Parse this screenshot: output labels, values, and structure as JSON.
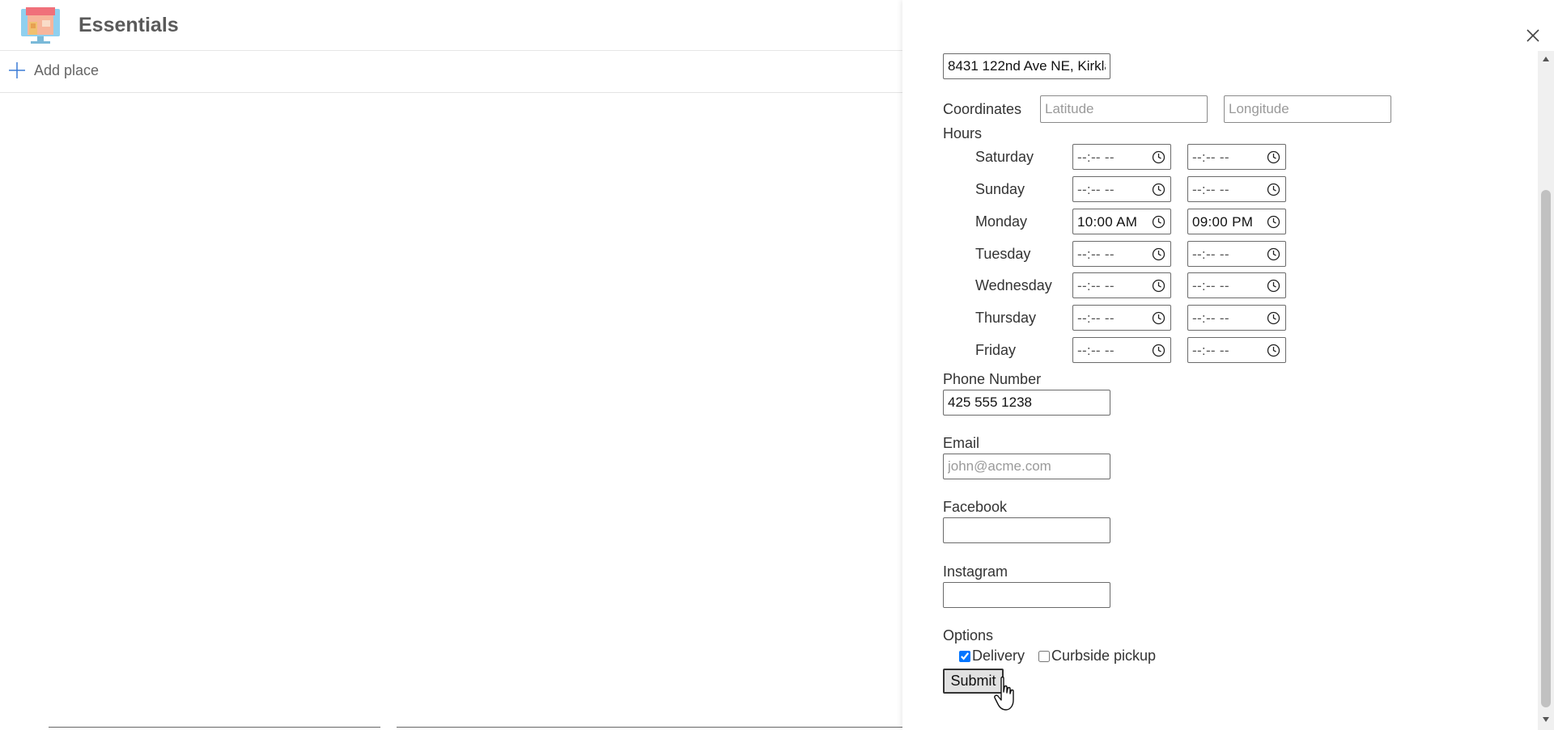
{
  "app": {
    "title": "Essentials",
    "logo_icon": "storefront-monitor-icon"
  },
  "toolbar": {
    "add_place_label": "Add place"
  },
  "form": {
    "address": {
      "value": "8431 122nd Ave NE, Kirkla"
    },
    "coordinates": {
      "label": "Coordinates",
      "latitude_placeholder": "Latitude",
      "longitude_placeholder": "Longitude"
    },
    "hours": {
      "label": "Hours",
      "days": [
        {
          "name": "Saturday",
          "open": "--:-- --",
          "close": "--:-- --"
        },
        {
          "name": "Sunday",
          "open": "--:-- --",
          "close": "--:-- --"
        },
        {
          "name": "Monday",
          "open": "10:00 AM",
          "close": "09:00 PM"
        },
        {
          "name": "Tuesday",
          "open": "--:-- --",
          "close": "--:-- --"
        },
        {
          "name": "Wednesday",
          "open": "--:-- --",
          "close": "--:-- --"
        },
        {
          "name": "Thursday",
          "open": "--:-- --",
          "close": "--:-- --"
        },
        {
          "name": "Friday",
          "open": "--:-- --",
          "close": "--:-- --"
        }
      ]
    },
    "phone": {
      "label": "Phone Number",
      "value": "425 555 1238"
    },
    "email": {
      "label": "Email",
      "placeholder": "john@acme.com"
    },
    "facebook": {
      "label": "Facebook",
      "value": ""
    },
    "instagram": {
      "label": "Instagram",
      "value": ""
    },
    "options": {
      "label": "Options",
      "delivery": {
        "label": "Delivery",
        "checked": true
      },
      "curbside": {
        "label": "Curbside pickup",
        "checked": false
      }
    },
    "submit_label": "Submit"
  },
  "colors": {
    "border": "#6b6b6b",
    "button_bg": "#e1e1e1",
    "scroll_thumb": "#c1c1c1"
  }
}
